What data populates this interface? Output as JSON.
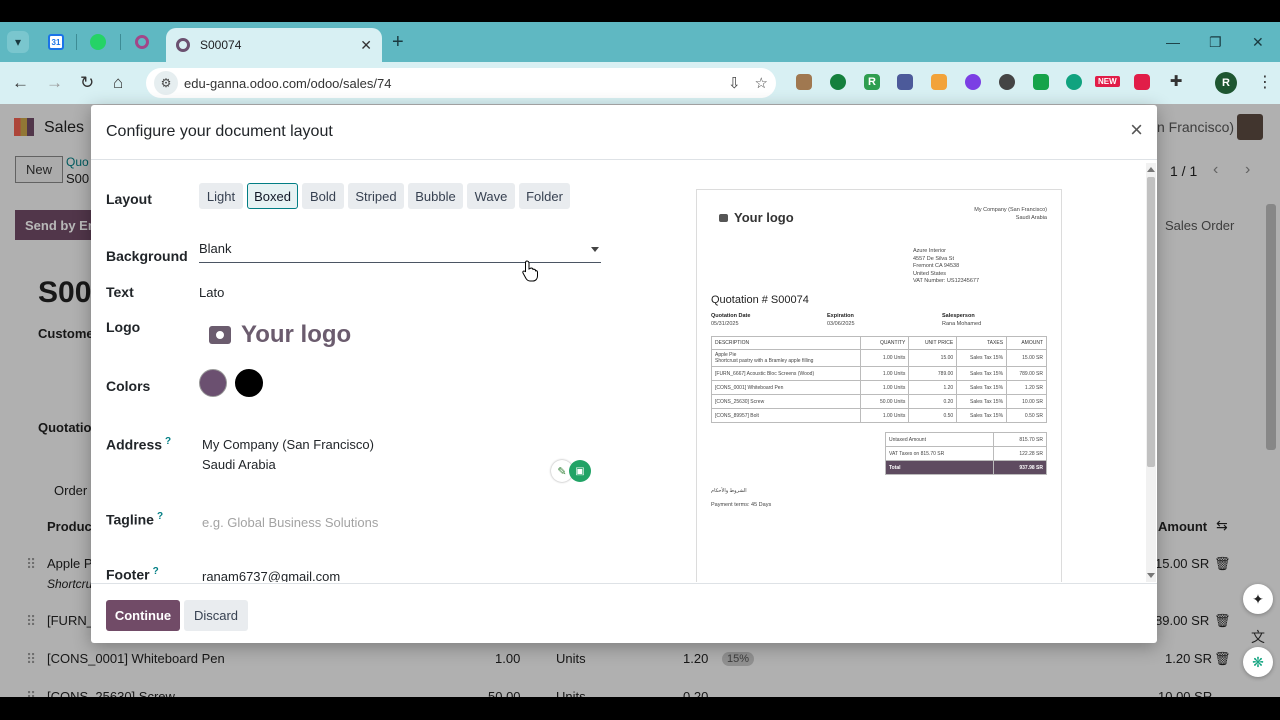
{
  "browser": {
    "tab_title": "S00074",
    "url": "edu-ganna.odoo.com/odoo/sales/74",
    "profile_initial": "R",
    "calendar_tab_label": "31",
    "ext_new_badge": "NEW",
    "ext_r_label": "R"
  },
  "background": {
    "app_name": "Sales",
    "new_button": "New",
    "breadcrumb_partial": "Quo",
    "record_partial": "S00",
    "company_partial": "n Francisco)",
    "pager": "1 / 1",
    "send_button_partial": "Send by Em",
    "sales_order_button": "Sales Order",
    "doc_name_partial": "S00",
    "customer_label_partial": "Custome",
    "quotation_label_partial": "Quotatio",
    "order_tab_partial": "Order",
    "product_header_partial": "Product",
    "amount_header": "Amount",
    "rows": [
      {
        "name": "Apple P",
        "desc": "Shortcru",
        "amount": "15.00 SR"
      },
      {
        "name": "[FURN_",
        "amount": "89.00 SR"
      },
      {
        "name": "[CONS_0001] Whiteboard Pen",
        "qty": "1.00",
        "uom": "Units",
        "price": "1.20",
        "tax": "15%",
        "amount": "1.20 SR"
      },
      {
        "name": "[CONS_25630] Screw",
        "qty": "50.00",
        "uom": "Units",
        "price": "0.20",
        "tax": "15%",
        "amount": "10.00 SR"
      }
    ]
  },
  "modal": {
    "title": "Configure your document layout",
    "close_symbol": "×",
    "labels": {
      "layout": "Layout",
      "background": "Background",
      "text": "Text",
      "logo": "Logo",
      "colors": "Colors",
      "address": "Address",
      "tagline": "Tagline",
      "footer": "Footer",
      "help_mark": "?"
    },
    "layout_options": [
      "Light",
      "Boxed",
      "Bold",
      "Striped",
      "Bubble",
      "Wave",
      "Folder"
    ],
    "selected_layout": "Boxed",
    "background_value": "Blank",
    "text_value": "Lato",
    "logo_text": "Your logo",
    "colors": {
      "primary": "#6b5070",
      "secondary": "#000000"
    },
    "address_line1": "My Company (San Francisco)",
    "address_line2": "Saudi Arabia",
    "tagline_placeholder": "e.g. Global Business Solutions",
    "footer_value": "ranam6737@gmail.com",
    "continue_label": "Continue",
    "discard_label": "Discard"
  },
  "preview": {
    "logo_text": "Your logo",
    "company_line1": "My Company (San Francisco)",
    "company_line2": "Saudi Arabia",
    "customer": [
      "Azure Interior",
      "4557 De Silva St",
      "Fremont CA 94538",
      "United States",
      "VAT Number: US12345677"
    ],
    "title": "Quotation # S00074",
    "quotation_date_label": "Quotation Date",
    "quotation_date": "05/31/2025",
    "expiration_label": "Expiration",
    "expiration": "03/06/2025",
    "salesperson_label": "Salesperson",
    "salesperson": "Rana Mohamed",
    "columns": [
      "DESCRIPTION",
      "QUANTITY",
      "UNIT PRICE",
      "TAXES",
      "AMOUNT"
    ],
    "lines": [
      {
        "desc": "Apple Pie",
        "desc2": "Shortcrust pastry with a Bramley apple filling",
        "qty": "1.00 Units",
        "price": "15.00",
        "tax": "Sales Tax 15%",
        "amount": "15.00 SR"
      },
      {
        "desc": "[FURN_6667] Acoustic Bloc Screens (Wood)",
        "qty": "1.00 Units",
        "price": "789.00",
        "tax": "Sales Tax 15%",
        "amount": "789.00 SR"
      },
      {
        "desc": "[CONS_0001] Whiteboard Pen",
        "qty": "1.00 Units",
        "price": "1.20",
        "tax": "Sales Tax 15%",
        "amount": "1.20 SR"
      },
      {
        "desc": "[CONS_25630] Screw",
        "qty": "50.00 Units",
        "price": "0.20",
        "tax": "Sales Tax 15%",
        "amount": "10.00 SR"
      },
      {
        "desc": "[CONS_89957] Bolt",
        "qty": "1.00 Units",
        "price": "0.50",
        "tax": "Sales Tax 15%",
        "amount": "0.50 SR"
      }
    ],
    "untaxed_label": "Untaxed Amount",
    "untaxed": "815.70 SR",
    "vat_label": "VAT Taxes on 815.70 SR",
    "vat": "122.28 SR",
    "total_label": "Total",
    "total": "937.98 SR",
    "rtl_text": "الشروط والأحكام",
    "payment_terms": "Payment terms: 45 Days"
  }
}
